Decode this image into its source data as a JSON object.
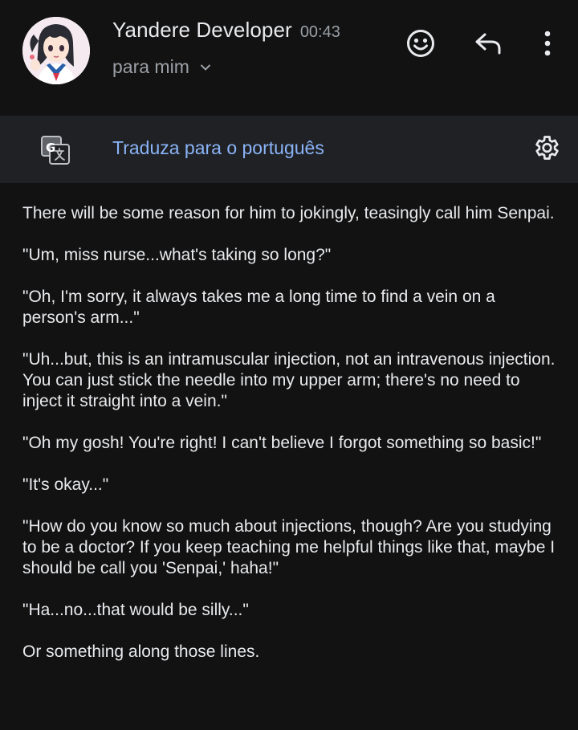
{
  "header": {
    "sender_name": "Yandere Developer",
    "time": "00:43",
    "recipient": "para mim",
    "icons": {
      "avatar": "anime-avatar",
      "react": "emoji-smile-icon",
      "reply": "reply-icon",
      "more": "more-vert-icon",
      "expand": "chevron-down-icon"
    }
  },
  "translate_bar": {
    "label": "Traduza para o português",
    "icons": {
      "translate": "google-translate-icon",
      "settings": "gear-icon"
    }
  },
  "message": {
    "paragraphs": [
      "There will be some reason for him to jokingly, teasingly call him Senpai.",
      "\"Um, miss nurse...what's taking so long?\"",
      "\"Oh, I'm sorry, it always takes me a long time to find a vein on a person's arm...\"",
      "\"Uh...but, this is an intramuscular injection, not an intravenous injection. You can just stick the needle into my upper arm; there's no need to inject it straight into a vein.\"",
      "\"Oh my gosh! You're right! I can't believe I forgot something so basic!\"",
      "\"It's okay...\"",
      "\"How do you know so much about injections, though? Are you studying to be a doctor? If you keep teaching me helpful things like that, maybe I should be call you 'Senpai,' haha!\"",
      "\"Ha...no...that would be silly...\"",
      "Or something along those lines."
    ]
  },
  "colors": {
    "background": "#121212",
    "translate_bar": "#202124",
    "link": "#8ab4f8",
    "secondary_text": "#9aa0a6",
    "primary_text": "#e8eaed"
  }
}
